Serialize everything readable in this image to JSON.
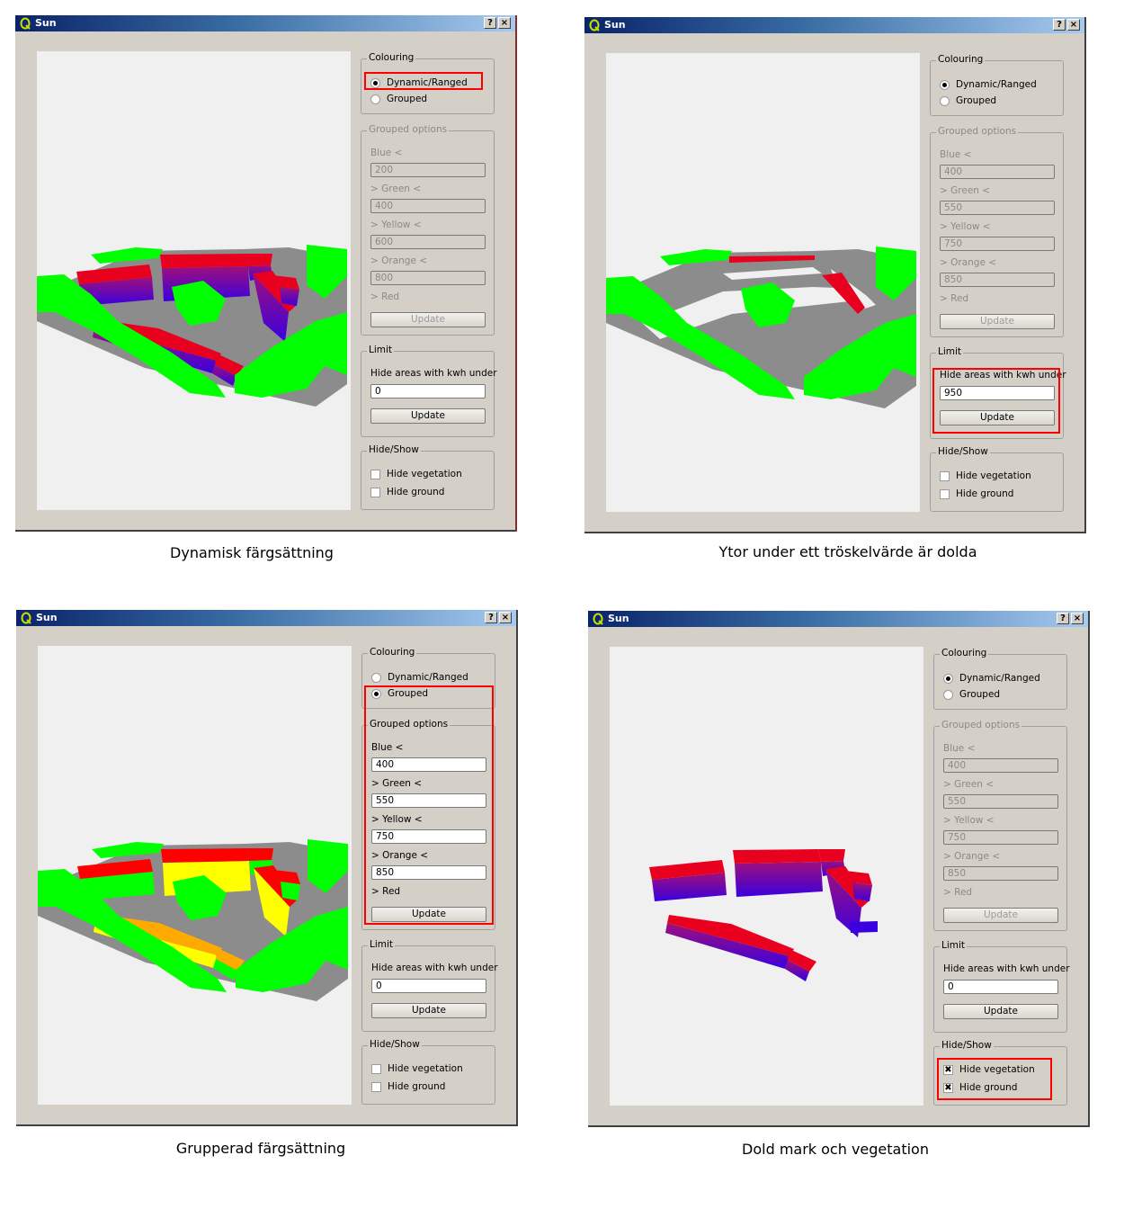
{
  "colors": {
    "titlebar_start": "#0a246a",
    "titlebar_end": "#a6caf0",
    "dialog_bg": "#d4d0c8",
    "viewport_bg": "#f0f0f0",
    "highlight": "#ff0000",
    "ground": "#8c8c8c",
    "vegetation": "#00ff00",
    "roof_high": "#e8001e",
    "wall_low": "#3a00e0",
    "group_blue": "#0000ff",
    "group_green": "#00ff00",
    "group_yellow": "#ffff00",
    "group_orange": "#ffaa00",
    "group_red": "#ff0000"
  },
  "labels": {
    "window_title": "Sun",
    "help_button": "?",
    "close_button": "×",
    "colouring_group": "Colouring",
    "dynamic_option": "Dynamic/Ranged",
    "grouped_option": "Grouped",
    "grouped_options_group": "Grouped options",
    "blue_label": "Blue <",
    "green_label": "> Green <",
    "yellow_label": "> Yellow <",
    "orange_label": "> Orange <",
    "red_label": "> Red",
    "update_button": "Update",
    "limit_group": "Limit",
    "limit_label": "Hide areas with kwh under",
    "hideshow_group": "Hide/Show",
    "hide_vegetation": "Hide vegetation",
    "hide_ground": "Hide ground"
  },
  "windows": [
    {
      "caption": "Dynamisk färgsättning",
      "colouring": "dynamic",
      "grouped_enabled": false,
      "thresholds": {
        "blue": "200",
        "green": "400",
        "yellow": "600",
        "orange": "800"
      },
      "limit_value": "0",
      "hide_vegetation": false,
      "hide_ground": false,
      "highlight": "colouring-dynamic",
      "scene": "dynamic"
    },
    {
      "caption": "Ytor under ett tröskelvärde är dolda",
      "colouring": "dynamic",
      "grouped_enabled": false,
      "thresholds": {
        "blue": "400",
        "green": "550",
        "yellow": "750",
        "orange": "850"
      },
      "limit_value": "950",
      "hide_vegetation": false,
      "hide_ground": false,
      "highlight": "limit",
      "scene": "threshold"
    },
    {
      "caption": "Grupperad färgsättning",
      "colouring": "grouped",
      "grouped_enabled": true,
      "thresholds": {
        "blue": "400",
        "green": "550",
        "yellow": "750",
        "orange": "850"
      },
      "limit_value": "0",
      "hide_vegetation": false,
      "hide_ground": false,
      "highlight": "grouped",
      "scene": "grouped"
    },
    {
      "caption": "Dold mark och vegetation",
      "colouring": "dynamic",
      "grouped_enabled": false,
      "thresholds": {
        "blue": "400",
        "green": "550",
        "yellow": "750",
        "orange": "850"
      },
      "limit_value": "0",
      "hide_vegetation": true,
      "hide_ground": true,
      "highlight": "hideshow",
      "scene": "hidden"
    }
  ]
}
